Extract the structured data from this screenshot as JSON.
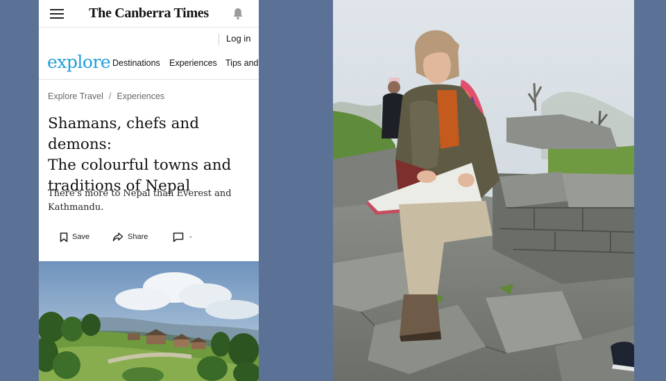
{
  "topbar": {
    "masthead": "The Canberra Times",
    "menu_icon": "hamburger-menu-icon",
    "notification_icon": "bell-icon"
  },
  "account": {
    "login_label": "Log in"
  },
  "nav": {
    "brand": "explore",
    "items": [
      {
        "label": "Destinations"
      },
      {
        "label": "Experiences"
      },
      {
        "label": "Tips and"
      }
    ]
  },
  "breadcrumb": [
    {
      "label": "Explore Travel"
    },
    {
      "label": "Experiences"
    }
  ],
  "breadcrumb_separator": "/",
  "article": {
    "headline_lines": [
      "Shamans, chefs and demons:",
      "The colourful towns and",
      "traditions of Nepal"
    ],
    "standfirst_lines": [
      "There's more to Nepal than Everest and",
      "Kathmandu."
    ],
    "actions": {
      "save_label": "Save",
      "share_label": "Share",
      "comments_label": "-"
    }
  },
  "colors": {
    "brand_blue": "#1f9fd8",
    "page_background": "#5b7296"
  }
}
